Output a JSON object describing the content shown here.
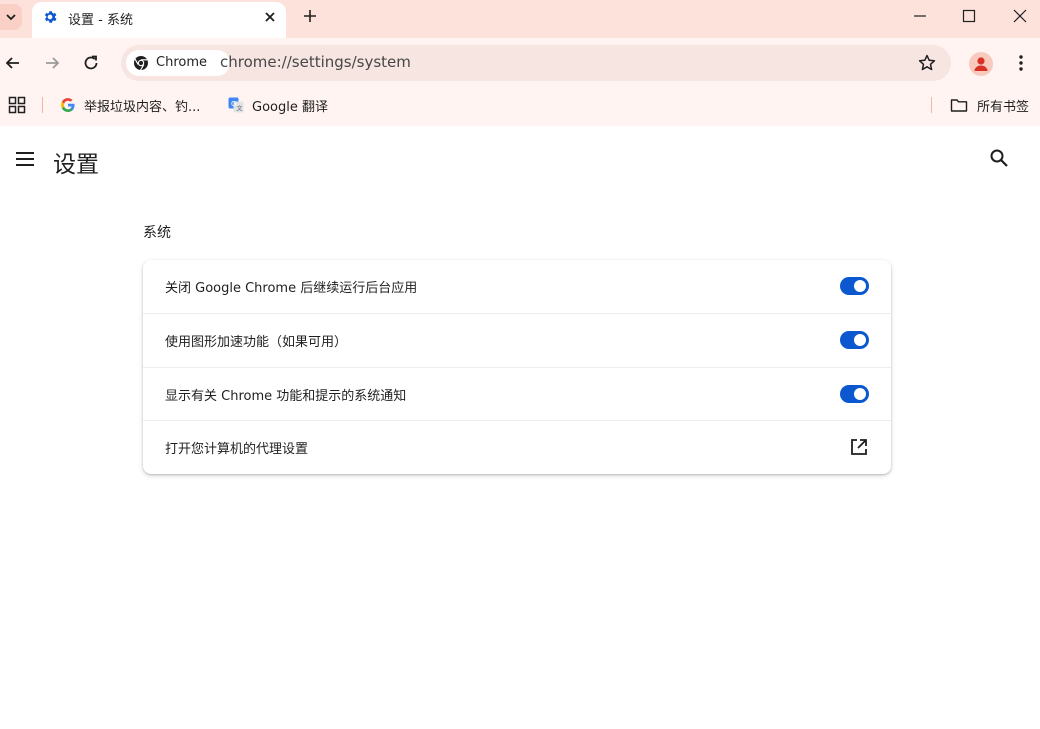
{
  "tab": {
    "title": "设置 - 系统",
    "favicon": "gear-icon"
  },
  "toolbar": {
    "chip_label": "Chrome",
    "url": "chrome://settings/system"
  },
  "bookmarks": {
    "items": [
      {
        "label": "举报垃圾内容、钓...",
        "icon": "google-icon"
      },
      {
        "label": "Google 翻译",
        "icon": "google-translate-icon"
      }
    ],
    "all_bookmarks": "所有书签"
  },
  "settings": {
    "page_title": "设置",
    "section_title": "系统",
    "rows": [
      {
        "label": "关闭 Google Chrome 后继续运行后台应用",
        "control": "toggle",
        "checked": true
      },
      {
        "label": "使用图形加速功能（如果可用）",
        "control": "toggle",
        "checked": true
      },
      {
        "label": "显示有关 Chrome 功能和提示的系统通知",
        "control": "toggle",
        "checked": true
      },
      {
        "label": "打开您计算机的代理设置",
        "control": "external-link"
      }
    ]
  },
  "colors": {
    "accent": "#0b57d0",
    "frame": "#fde2dc",
    "toolbar": "#fff4f1"
  }
}
